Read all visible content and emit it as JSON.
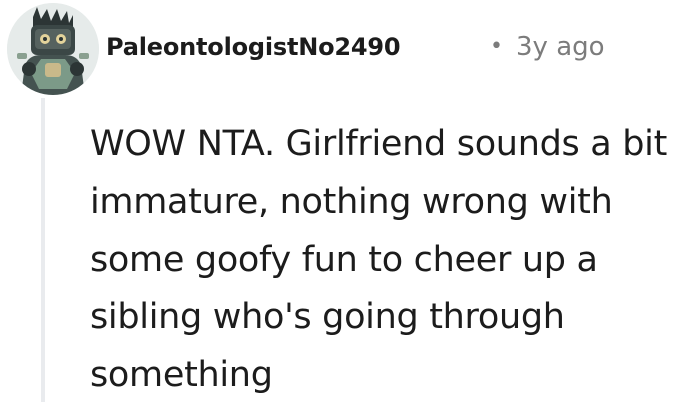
{
  "comment": {
    "username": "PaleontologistNo2490",
    "separator": "•",
    "timestamp": "3y ago",
    "body": "WOW NTA. Girlfriend sounds a bit immature, nothing wrong with some goofy fun to cheer up a sibling who's going through something",
    "avatar_icon": "robot-avatar-icon"
  }
}
